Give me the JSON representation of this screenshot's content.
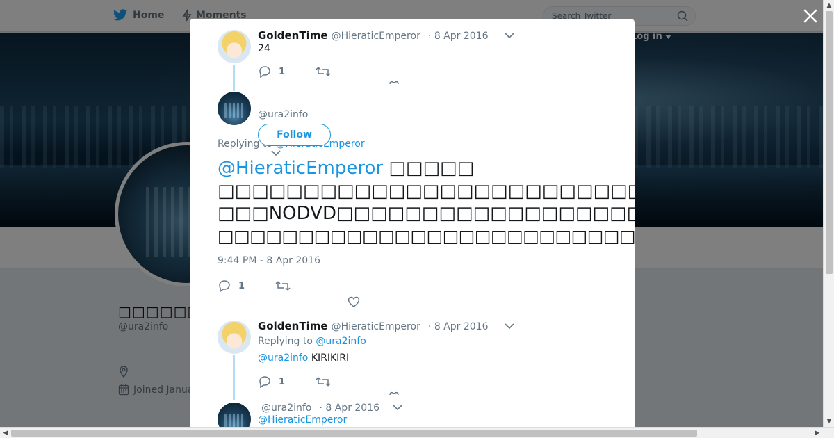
{
  "topbar": {
    "home_label": "Home",
    "moments_label": "Moments",
    "search_placeholder": "Search Twitter",
    "login_label": "Log in"
  },
  "profile": {
    "display_name": "□□□□□□□□□",
    "handle": "@ura2info",
    "joined_text": "Joined Janua"
  },
  "modal": {
    "tweet_1": {
      "name": "GoldenTime",
      "handle": "@HieraticEmperor",
      "date": "· 8 Apr 2016",
      "text": "24",
      "reply_count": "1"
    },
    "main_tweet": {
      "handle": "@ura2info",
      "follow_label": "Follow",
      "replying_prefix": "Replying to",
      "replying_handle": "@HieraticEmperor",
      "mention": "@HieraticEmperor",
      "line_1_rest": " □□□□□",
      "line_2": "□□□□□□□□□□□□□□□□□□□□□□□□□",
      "line_3": "□□□NODVD□□□□□□□□□□□□□□□□□□□□□□□",
      "line_4": "□□□□□□□□□□□□□□□□□□□□□□□□□□□□□□□□□□",
      "timestamp": "9:44 PM - 8 Apr 2016",
      "reply_count": "1"
    },
    "tweet_2": {
      "name": "GoldenTime",
      "handle": "@HieraticEmperor",
      "date": "· 8 Apr 2016",
      "replying_prefix": "Replying to",
      "replying_handle": "@ura2info",
      "mention": "@ura2info",
      "text": " KIRIKIRI",
      "reply_count": "1"
    },
    "tweet_3": {
      "handle": "@ura2info",
      "date": "· 8 Apr 2016",
      "mention": "@HieraticEmperor"
    }
  },
  "colors": {
    "accent": "#1b95e0",
    "text": "#14171a",
    "muted": "#657786",
    "thread_line": "#b5dcf5"
  }
}
